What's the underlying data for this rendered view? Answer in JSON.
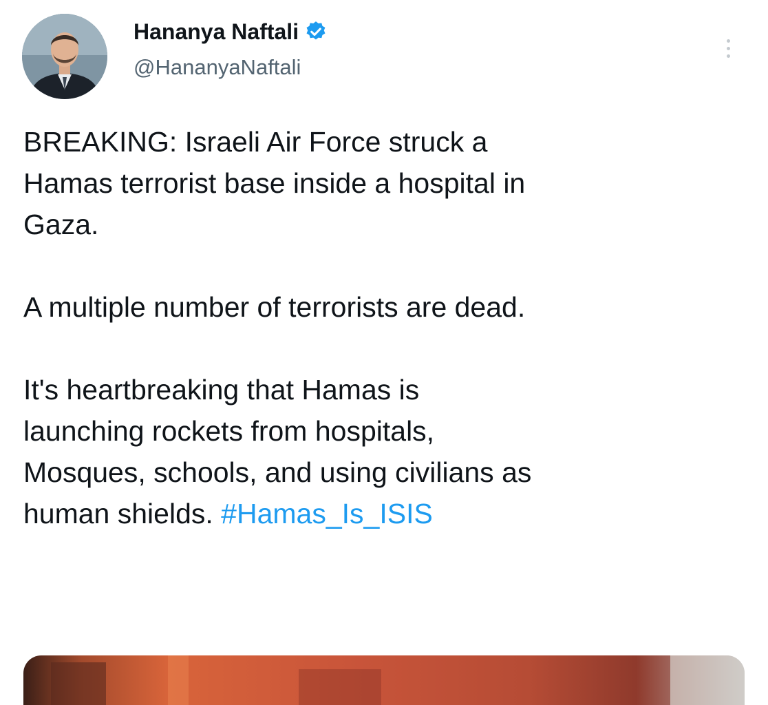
{
  "author": {
    "display_name": "Hananya Naftali",
    "handle": "@HananyaNaftali",
    "verified_icon": "verified-badge-icon",
    "avatar_icon": "profile-photo"
  },
  "menu": {
    "icon": "more-vertical-icon"
  },
  "tweet": {
    "para1_line1": "BREAKING: Israeli Air Force struck a",
    "para1_line2": "Hamas terrorist base inside a hospital in",
    "para1_line3": "Gaza.",
    "para2_line1": "A multiple number of terrorists are dead.",
    "para3_line1": "It's heartbreaking that Hamas is",
    "para3_line2": "launching rockets from hospitals,",
    "para3_line3": "Mosques, schools, and using civilians as",
    "para3_line4_prefix": "human shields. ",
    "hashtag": "#Hamas_Is_ISIS"
  },
  "colors": {
    "text": "#0f1419",
    "secondary": "#536471",
    "link": "#1d9bf0",
    "verified": "#1d9bf0"
  }
}
